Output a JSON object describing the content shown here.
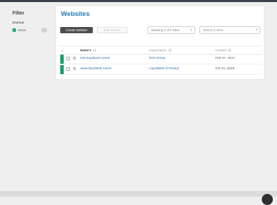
{
  "sidebar": {
    "title": "Filter",
    "status_label": "STATUS",
    "active_label": "Active",
    "active_count": "2"
  },
  "page": {
    "title": "Websites",
    "create_button": "Create Website",
    "bulk_button": "Bulk Actions",
    "showing_label": "Showing 2 of 2 Sites",
    "search_placeholder": "Search 2 Sites"
  },
  "table": {
    "headers": {
      "select": "§",
      "name": "Name",
      "organization": "Organization",
      "created": "Created"
    },
    "rows": [
      {
        "name": "test.liquidweb.name",
        "organization": "Test Group",
        "created": "Feb 27, 2017",
        "status": "active"
      },
      {
        "name": "www.liquidweb.name",
        "organization": "LiquidWeb (Primary)",
        "created": "Oct 31, 2016",
        "status": "active"
      }
    ]
  },
  "colors": {
    "accent": "#287bb0",
    "status_active": "#16a06a",
    "primary_button": "#4d4d4d"
  },
  "icons": {
    "search": "search-icon",
    "gear": "gear-icon",
    "help": "help-icon",
    "sort": "sort-desc-icon"
  }
}
